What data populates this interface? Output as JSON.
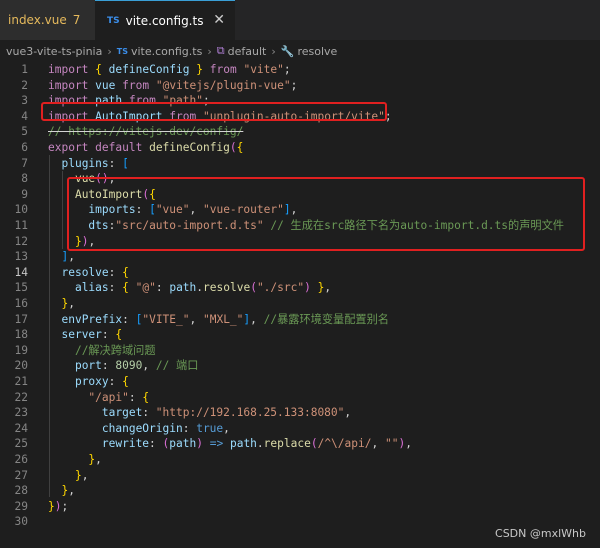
{
  "tabs": [
    {
      "label": "index.vue",
      "badge": "7",
      "icon": "vue-file-icon"
    },
    {
      "label": "vite.config.ts",
      "icon": "ts-file-icon",
      "close": "✕"
    }
  ],
  "breadcrumb": {
    "project": "vue3-vite-ts-pinia",
    "file": "vite.config.ts",
    "export": "default",
    "symbol": "resolve"
  },
  "lines": [
    {
      "n": "1",
      "code": "import { defineConfig } from \"vite\";"
    },
    {
      "n": "2",
      "code": "import vue from \"@vitejs/plugin-vue\";"
    },
    {
      "n": "3",
      "code": "import path from \"path\";"
    },
    {
      "n": "4",
      "code": "import AutoImport from \"unplugin-auto-import/vite\";"
    },
    {
      "n": "5",
      "code": "// https://vitejs.dev/config/"
    },
    {
      "n": "6",
      "code": "export default defineConfig({"
    },
    {
      "n": "7",
      "code": "  plugins: ["
    },
    {
      "n": "8",
      "code": "    vue(),"
    },
    {
      "n": "9",
      "code": "    AutoImport({"
    },
    {
      "n": "10",
      "code": "      imports: [\"vue\", \"vue-router\"],"
    },
    {
      "n": "11",
      "code": "      dts:\"src/auto-import.d.ts\" // 生成在src路径下名为auto-import.d.ts的声明文件"
    },
    {
      "n": "12",
      "code": "    }),"
    },
    {
      "n": "13",
      "code": "  ],"
    },
    {
      "n": "14",
      "code": "  resolve: {"
    },
    {
      "n": "15",
      "code": "    alias: { \"@\": path.resolve(\"./src\") },"
    },
    {
      "n": "16",
      "code": "  },"
    },
    {
      "n": "17",
      "code": "  envPrefix: [\"VITE_\", \"MXL_\"], //暴露环境变量配置别名"
    },
    {
      "n": "18",
      "code": "  server: {"
    },
    {
      "n": "19",
      "code": "    //解决跨域问题"
    },
    {
      "n": "20",
      "code": "    port: 8090, // 端口"
    },
    {
      "n": "21",
      "code": "    proxy: {"
    },
    {
      "n": "22",
      "code": "      \"/api\": {"
    },
    {
      "n": "23",
      "code": "        target: \"http://192.168.25.133:8080\","
    },
    {
      "n": "24",
      "code": "        changeOrigin: true,"
    },
    {
      "n": "25",
      "code": "        rewrite: (path) => path.replace(/^\\/api/, \"\"),"
    },
    {
      "n": "26",
      "code": "      },"
    },
    {
      "n": "27",
      "code": "    },"
    },
    {
      "n": "28",
      "code": "  },"
    },
    {
      "n": "29",
      "code": "});"
    },
    {
      "n": "30",
      "code": ""
    }
  ],
  "watermark": "CSDN @mxlWhb",
  "colors": {
    "highlight_box": "#e02020",
    "editor_bg": "#1e1e1e"
  }
}
